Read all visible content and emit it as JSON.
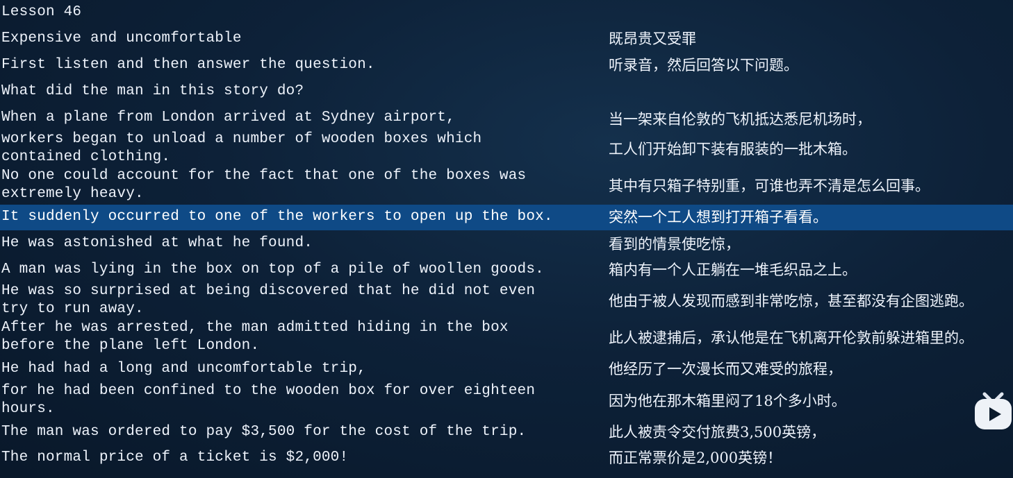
{
  "title": "Lesson 46",
  "lines": [
    {
      "en": "Expensive and uncomfortable",
      "zh": "既昂贵又受罪"
    },
    {
      "en": "First listen and then answer the question.",
      "zh": "听录音，然后回答以下问题。"
    },
    {
      "en": "What did the man in this story do?",
      "zh": ""
    },
    {
      "en": "When a plane from London arrived at Sydney airport,",
      "zh": "当一架来自伦敦的飞机抵达悉尼机场时，"
    },
    {
      "en": "workers began to unload a number of wooden boxes which\ncontained clothing.",
      "zh": "工人们开始卸下装有服装的一批木箱。"
    },
    {
      "en": "No one could account for the fact that one of the boxes was\nextremely heavy.",
      "zh": "其中有只箱子特别重，可谁也弄不清是怎么回事。"
    },
    {
      "en": "It suddenly occurred to one of the workers to open up the box.",
      "zh": "突然一个工人想到打开箱子看看。"
    },
    {
      "en": "He was astonished at what he found.",
      "zh": "看到的情景使吃惊，"
    },
    {
      "en": "A man was lying in the box on top of a pile of woollen goods.",
      "zh": "箱内有一个人正躺在一堆毛织品之上。"
    },
    {
      "en": "He was so surprised at being discovered that he did not even\ntry to run away.",
      "zh": "他由于被人发现而感到非常吃惊，甚至都没有企图逃跑。"
    },
    {
      "en": "After he was arrested, the man admitted hiding in the box\nbefore the plane left London.",
      "zh": "此人被逮捕后，承认他是在飞机离开伦敦前躲进箱里的。"
    },
    {
      "en": "He had had a long and uncomfortable trip,",
      "zh": "他经历了一次漫长而又难受的旅程，"
    },
    {
      "en": "for he had been confined to the wooden box for over eighteen\nhours.",
      "zh": "因为他在那木箱里闷了18个多小时。"
    },
    {
      "en": "The man was ordered to pay $3,500 for the cost of the trip.",
      "zh": "此人被责令交付旅费3,500英镑，"
    },
    {
      "en": "The normal price of a ticket is $2,000!",
      "zh": "而正常票价是2,000英镑！"
    }
  ],
  "selected_index": 6,
  "colors": {
    "background": "#0b1a2b",
    "highlight": "#0f4a86",
    "text": "#eef3fb"
  },
  "watermark_icon": "tv-play-logo-icon"
}
